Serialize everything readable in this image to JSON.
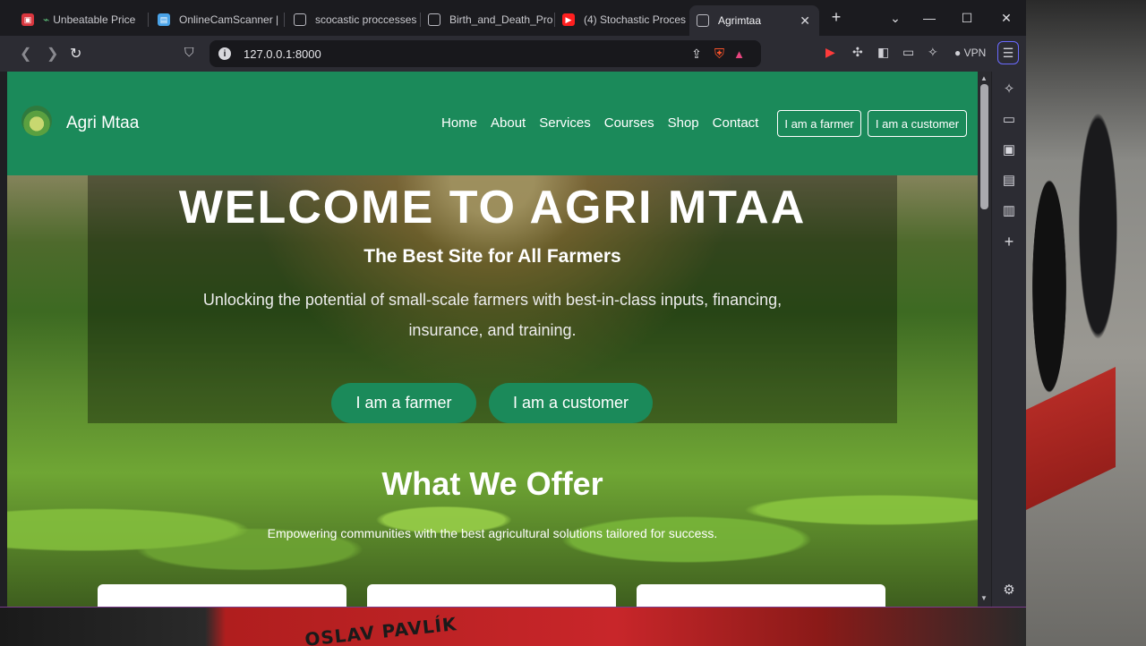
{
  "tabs": [
    {
      "title": "Unbeatable Price",
      "icon": "shopping-bag-icon"
    },
    {
      "title": "OnlineCamScanner |",
      "icon": "scanner-icon"
    },
    {
      "title": "scocastic proccesses",
      "icon": "globe-icon"
    },
    {
      "title": "Birth_and_Death_Pro",
      "icon": "globe-icon"
    },
    {
      "title": "(4) Stochastic Proces",
      "icon": "youtube-icon"
    },
    {
      "title": "Agrimtaa",
      "icon": "globe-icon",
      "active": true
    }
  ],
  "toolbar": {
    "url": "127.0.0.1:8000",
    "vpn_label": "VPN"
  },
  "site": {
    "brand": "Agri Mtaa",
    "menu": [
      "Home",
      "About",
      "Services",
      "Courses",
      "Shop",
      "Contact"
    ],
    "nav_farmer": "I am a farmer",
    "nav_customer": "I am a customer",
    "hero_title": "WELCOME TO AGRI MTAA",
    "hero_subtitle": "The Best Site for All Farmers",
    "hero_description": "Unlocking the potential of small-scale farmers with best-in-class inputs, financing, insurance, and training.",
    "hero_farmer_btn": "I am a farmer",
    "hero_customer_btn": "I am a customer",
    "offer_title": "What We Offer",
    "offer_description": "Empowering communities with the best agricultural solutions tailored for success.",
    "primary_color": "#1b8a5a"
  },
  "desktop": {
    "banner_text": "OSLAV PAVLÍK"
  }
}
